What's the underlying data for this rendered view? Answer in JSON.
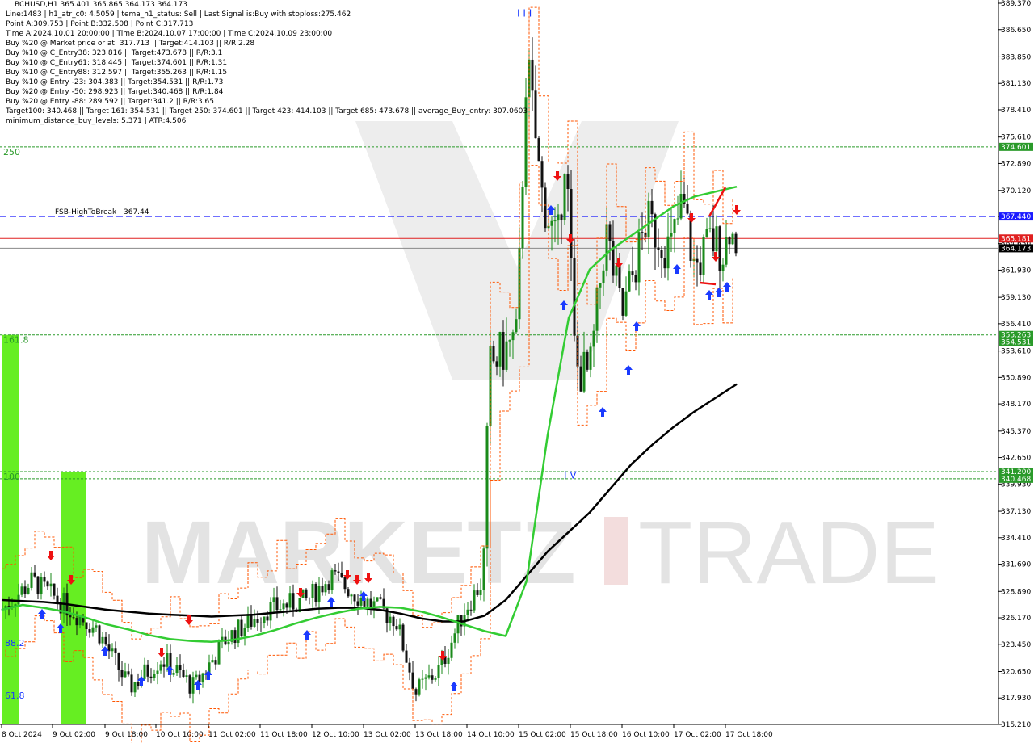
{
  "header": {
    "symbol_line": "BCHUSD,H1  365.401 365.865 364.173 364.173",
    "lines": [
      "Line:1483  |  h1_atr_c0: 4.5059  |  tema_h1_status: Sell  |  Last Signal is:Buy with stoploss:275.462",
      "Point A:309.753  |  Point B:332.508  |  Point C:317.713",
      "Time A:2024.10.01 20:00:00  |  Time B:2024.10.07 17:00:00  |  Time C:2024.10.09 23:00:00",
      "Buy %20 @ Market price or at: 317.713  ||  Target:414.103  ||  R/R:2.28",
      "Buy %10 @ C_Entry38: 323.816  ||  Target:473.678  ||  R/R:3.1",
      "Buy %10 @ C_Entry61: 318.445  ||  Target:374.601  ||  R/R:1.31",
      "Buy %10 @ C_Entry88: 312.597  ||  Target:355.263  ||  R/R:1.15",
      "Buy %10 @ Entry -23: 304.383  ||  Target:354.531  ||  R/R:1.73",
      "Buy %20 @ Entry -50: 298.923  ||  Target:340.468  ||  R/R:1.84",
      "Buy %20 @ Entry -88: 289.592  ||  Target:341.2  ||  R/R:3.65",
      "Target100: 340.468  ||  Target 161: 354.531  ||  Target 250: 374.601  ||  Target 423: 414.103  ||  Target 685: 473.678  ||  average_Buy_entry: 307.0603",
      "minimum_distance_buy_levels: 5.371  |  ATR:4.506"
    ]
  },
  "chart_data": {
    "type": "candlestick",
    "title": "BCHUSD,H1",
    "ylim": [
      315.21,
      389.37
    ],
    "y_ticks": [
      "389.370",
      "386.650",
      "383.850",
      "381.130",
      "378.410",
      "375.610",
      "372.890",
      "370.120",
      "367.440",
      "364.650",
      "361.930",
      "359.130",
      "356.410",
      "353.610",
      "350.890",
      "348.170",
      "345.370",
      "342.650",
      "339.930",
      "337.130",
      "334.410",
      "331.690",
      "328.890",
      "326.170",
      "323.450",
      "320.650",
      "317.930",
      "315.210"
    ],
    "x_ticks": [
      "8 Oct 2024",
      "9 Oct 02:00",
      "9 Oct 18:00",
      "10 Oct 10:00",
      "11 Oct 02:00",
      "11 Oct 18:00",
      "12 Oct 10:00",
      "13 Oct 02:00",
      "13 Oct 18:00",
      "14 Oct 10:00",
      "15 Oct 02:00",
      "15 Oct 18:00",
      "16 Oct 10:00",
      "17 Oct 02:00",
      "17 Oct 18:00"
    ],
    "current_price": "364.173",
    "levels": [
      {
        "name": "FSB-HighToBreak",
        "label": "FSB-HighToBreak | 367.44",
        "value": 367.44,
        "tag": "367.440",
        "color": "#1a1aff",
        "style": "dashed"
      },
      {
        "name": "365.181",
        "value": 365.181,
        "tag": "365.181",
        "color": "#e02020",
        "style": "solid"
      },
      {
        "name": "374.601",
        "value": 374.601,
        "tag": "374.601",
        "color": "#2a9a2a",
        "style": "dotted",
        "left_label": "250"
      },
      {
        "name": "355.263",
        "value": 355.263,
        "tag": "355.263",
        "color": "#2a9a2a",
        "style": "dotted",
        "left_label": "161.8"
      },
      {
        "name": "354.531",
        "value": 354.531,
        "tag": "354.531",
        "color": "#2a9a2a",
        "style": "dotted"
      },
      {
        "name": "341.200",
        "value": 341.2,
        "tag": "341.200",
        "color": "#2a9a2a",
        "style": "dotted",
        "left_label": "100"
      },
      {
        "name": "340.468",
        "value": 340.468,
        "tag": "340.468",
        "color": "#2a9a2a",
        "style": "dotted"
      }
    ],
    "side_labels": [
      {
        "text": "88.2",
        "value": 323.6
      },
      {
        "text": "61.8",
        "value": 318.2
      }
    ],
    "wave_labels": [
      {
        "text": "I I I",
        "value": 388.0
      },
      {
        "text": "I V",
        "value": 340.5
      }
    ],
    "ma_fast": [
      327,
      327.5,
      327.2,
      326.8,
      326.2,
      325.5,
      325,
      324.4,
      324,
      323.8,
      323.7,
      323.9,
      324.3,
      324.9,
      325.6,
      326.2,
      326.7,
      327.1,
      327.3,
      327.2,
      326.8,
      326.2,
      325.5,
      324.8,
      324.3,
      330,
      345,
      357,
      362,
      364,
      365.5,
      367,
      368.5,
      369.5,
      370,
      370.5
    ],
    "ma_slow": [
      328,
      327.9,
      327.8,
      327.6,
      327.3,
      327,
      326.8,
      326.6,
      326.5,
      326.4,
      326.3,
      326.4,
      326.5,
      326.7,
      326.9,
      327.1,
      327.2,
      327.2,
      327,
      326.6,
      326.1,
      325.8,
      325.8,
      326.4,
      328,
      330.5,
      333,
      335,
      337,
      339.5,
      342,
      344,
      345.8,
      347.4,
      348.8,
      350.2
    ],
    "colors": {
      "bull": "#1a8a1a",
      "bear": "#111111",
      "ma_fast": "#33cc33",
      "ma_slow": "#000000",
      "zone": "#66ee22",
      "channel": "#ff5500",
      "buy_arrow": "#1a3aff",
      "sell_arrow": "#ee1111"
    }
  }
}
